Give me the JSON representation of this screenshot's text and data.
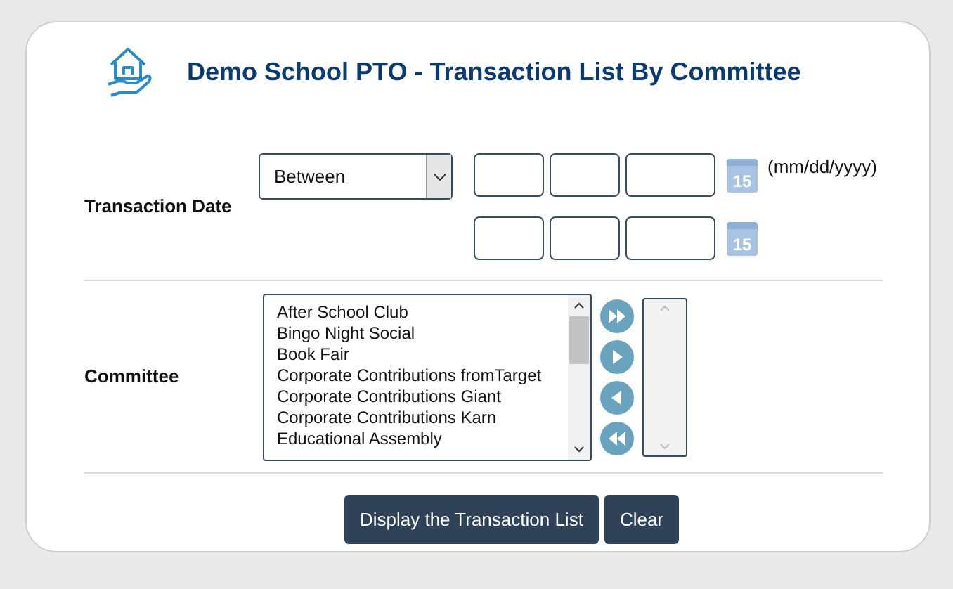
{
  "title": "Demo School PTO - Transaction List By Committee",
  "transaction_date": {
    "label": "Transaction Date",
    "operator": "Between",
    "format_hint": "(mm/dd/yyyy)",
    "calendar_icon_text": [
      "15",
      "15"
    ]
  },
  "committee": {
    "label": "Committee",
    "available": [
      "After School Club",
      "Bingo Night Social",
      "Book Fair",
      "Corporate Contributions fromTarget",
      "Corporate Contributions Giant",
      "Corporate Contributions Karn",
      "Educational Assembly"
    ]
  },
  "buttons": [
    {
      "label": "Display the Transaction List"
    },
    {
      "label": "Clear"
    }
  ]
}
